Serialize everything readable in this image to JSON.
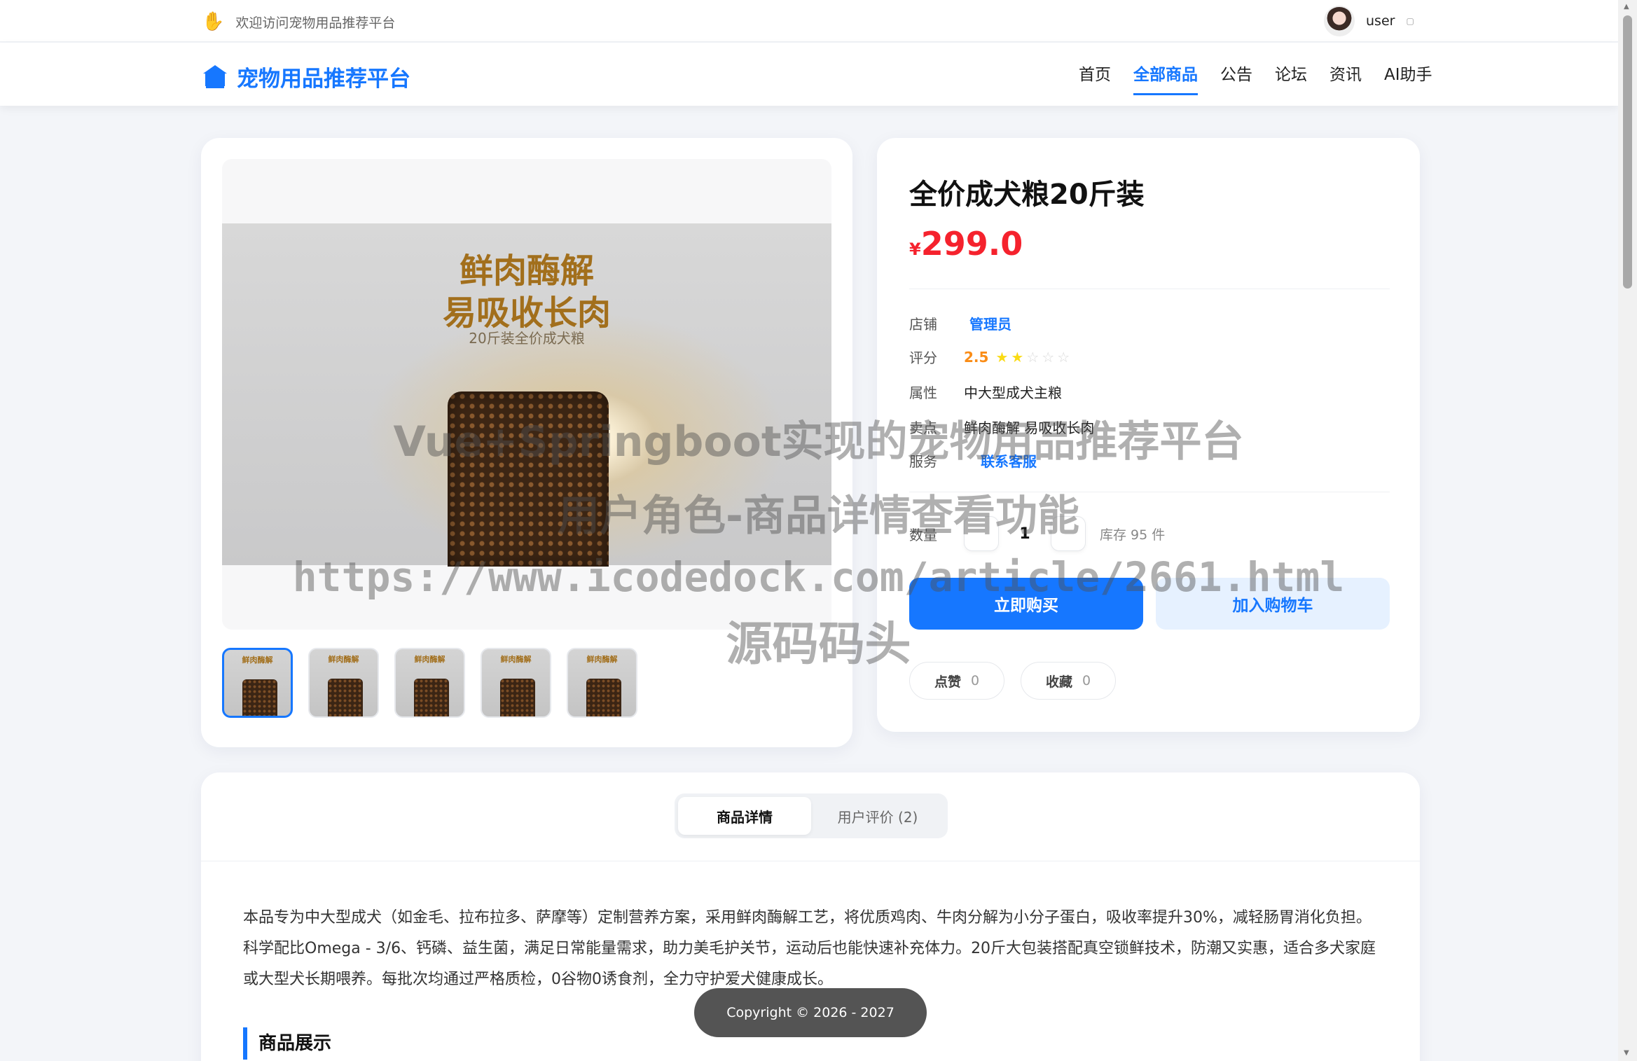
{
  "topbar": {
    "welcome_icon": "hand-icon",
    "welcome_text": "欢迎访问宠物用品推荐平台",
    "username": "user",
    "caret": "▢"
  },
  "brand": {
    "name": "宠物用品推荐平台",
    "icon": "bank-icon"
  },
  "nav": {
    "items": [
      "首页",
      "全部商品",
      "公告",
      "论坛",
      "资讯",
      "AI助手"
    ],
    "active": "全部商品"
  },
  "product": {
    "image_text": {
      "line1": "鲜肉酶解",
      "line2": "易吸收长肉",
      "line3": "20斤装全价成犬粮"
    },
    "thumb_text": "鲜肉酶解\n易吸收长肉",
    "thumb_count": 5,
    "title": "全价成犬粮20斤装",
    "currency": "¥",
    "price": "299.0",
    "shop_label": "店铺",
    "shop_value": "管理员",
    "rating_label": "评分",
    "rating_value": "2.5",
    "rating_stars": 2.5,
    "attr_label": "属性",
    "attr_value": "中大型成犬主粮",
    "feature_label": "卖点",
    "feature_value": "鲜肉酶解 易吸收长肉",
    "service_label": "服务",
    "service_value": "联系客服",
    "qty_label": "数量",
    "qty_value": "1",
    "stock_text": "库存 95 件",
    "buy_label": "立即购买",
    "cart_label": "加入购物车",
    "like_label": "点赞",
    "like_count": "0",
    "fav_label": "收藏",
    "fav_count": "0"
  },
  "detail": {
    "tab_detail": "商品详情",
    "tab_reviews": "用户评价 (2)",
    "description": "本品专为中大型成犬（如金毛、拉布拉多、萨摩等）定制营养方案，采用鲜肉酶解工艺，将优质鸡肉、牛肉分解为小分子蛋白，吸收率提升30%，减轻肠胃消化负担。科学配比Omega - 3/6、钙磷、益生菌，满足日常能量需求，助力美毛护关节，运动后也能快速补充体力。20斤大包装搭配真空锁鲜技术，防潮又实惠，适合多犬家庭或大型犬长期喂养。每批次均通过严格质检，0谷物0诱食剂，全力守护爱犬健康成长。",
    "section_title": "商品展示"
  },
  "footer": {
    "copyright": "Copyright © 2026 - 2027"
  },
  "watermark": {
    "line1": "Vue+Springboot实现的宠物用品推荐平台",
    "line2": "用户角色-商品详情查看功能",
    "line3": "https://www.icodedock.com/article/2661.html",
    "line4": "源码码头"
  },
  "colors": {
    "accent": "#1677ff",
    "price": "#f5222d",
    "star": "#fadb14",
    "score": "#fa8c16"
  }
}
